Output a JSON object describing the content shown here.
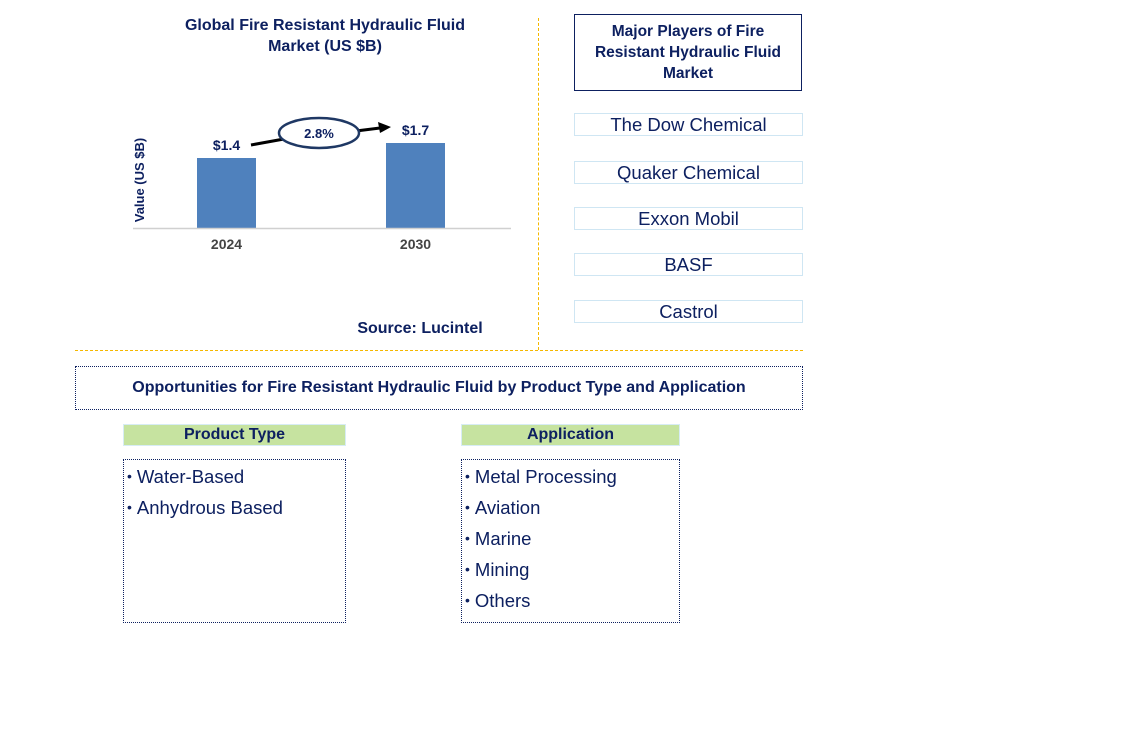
{
  "chart_data": {
    "type": "bar",
    "title": "Global Fire Resistant Hydraulic Fluid Market (US $B)",
    "xlabel": "",
    "ylabel": "Value (US $B)",
    "categories": [
      "2024",
      "2030"
    ],
    "values": [
      1.4,
      1.7
    ],
    "data_labels": [
      "$1.4",
      "$1.7"
    ],
    "ylim": [
      0,
      2.4
    ],
    "grid": false,
    "bar_color": "#4f81bd",
    "annotation": {
      "text": "2.8%",
      "meaning": "CAGR 2024-2030",
      "shape": "ellipse with arrow"
    }
  },
  "source": "Source: Lucintel",
  "players": {
    "heading": "Major Players of Fire Resistant Hydraulic Fluid Market",
    "items": [
      "The Dow Chemical",
      "Quaker Chemical",
      "Exxon Mobil",
      "BASF",
      "Castrol"
    ]
  },
  "opportunities": {
    "heading": "Opportunities for Fire Resistant Hydraulic Fluid by Product Type and Application",
    "product_type": {
      "heading": "Product Type",
      "items": [
        "Water-Based",
        "Anhydrous Based"
      ]
    },
    "application": {
      "heading": "Application",
      "items": [
        "Metal Processing",
        "Aviation",
        "Marine",
        "Mining",
        "Others"
      ]
    }
  },
  "colors": {
    "text": "#0d2060",
    "bar": "#4f81bd",
    "divider": "#f5b800",
    "category_header": "#c6e3a0",
    "player_border": "#cfe6f3"
  }
}
